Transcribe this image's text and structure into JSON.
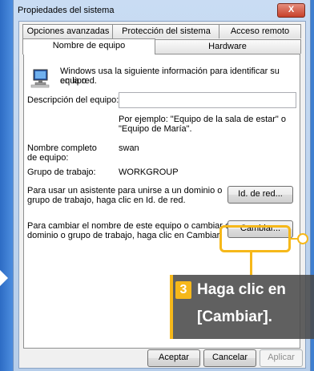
{
  "window": {
    "title": "Propiedades del sistema",
    "close_label": "X"
  },
  "tabs": {
    "row1": [
      "Opciones avanzadas",
      "Protección del sistema",
      "Acceso remoto"
    ],
    "row2": [
      "Nombre de equipo",
      "Hardware"
    ]
  },
  "panel": {
    "intro": [
      "Windows usa la siguiente información para identificar su equipo",
      "en la red."
    ],
    "description_label": "Descripción del equipo:",
    "description_value": "",
    "example": [
      "Por ejemplo: \"Equipo de la sala de estar\" o",
      "\"Equipo de María\"."
    ],
    "fullname_label": [
      "Nombre completo",
      "de equipo:"
    ],
    "fullname_value": "swan",
    "workgroup_label": "Grupo de trabajo:",
    "workgroup_value": "WORKGROUP",
    "domain_text": [
      "Para usar un asistente para unirse a un dominio o",
      "grupo de trabajo, haga clic en Id. de red."
    ],
    "network_id_button": "Id. de red...",
    "rename_text": [
      "Para cambiar el nombre de este equipo o cambiar el",
      "dominio o grupo de trabajo, haga clic en Cambiar."
    ],
    "change_button": "Cambiar..."
  },
  "footer": {
    "ok": "Aceptar",
    "cancel": "Cancelar",
    "apply": "Aplicar"
  },
  "callout": {
    "step": "3",
    "line1": "Haga clic en",
    "line2": "[Cambiar]."
  },
  "colors": {
    "accent": "#f6b81a",
    "titlebar": "#c9dcf3",
    "close": "#c8412a"
  }
}
